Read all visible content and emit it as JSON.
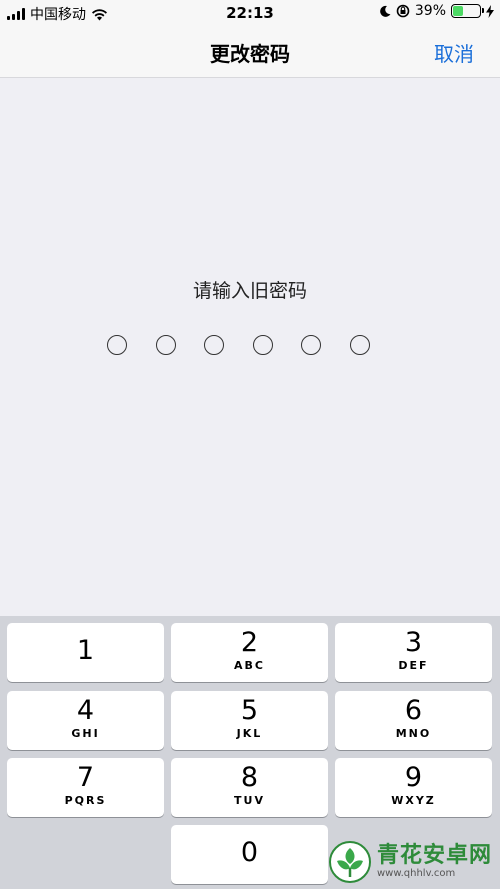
{
  "status_bar": {
    "carrier": "中国移动",
    "time": "22:13",
    "battery_percent": "39%",
    "battery_level": 0.39,
    "icons": [
      "signal-icon",
      "wifi-icon",
      "moon-icon",
      "rotation-lock-icon",
      "battery-icon",
      "charging-icon"
    ]
  },
  "nav": {
    "title": "更改密码",
    "cancel_label": "取消"
  },
  "passcode": {
    "prompt": "请输入旧密码",
    "digits_total": 6,
    "digits_entered": 0
  },
  "keypad": {
    "keys": [
      {
        "num": "1",
        "letters": ""
      },
      {
        "num": "2",
        "letters": "ABC"
      },
      {
        "num": "3",
        "letters": "DEF"
      },
      {
        "num": "4",
        "letters": "GHI"
      },
      {
        "num": "5",
        "letters": "JKL"
      },
      {
        "num": "6",
        "letters": "MNO"
      },
      {
        "num": "7",
        "letters": "PQRS"
      },
      {
        "num": "8",
        "letters": "TUV"
      },
      {
        "num": "9",
        "letters": "WXYZ"
      },
      {
        "num": "0",
        "letters": ""
      }
    ]
  },
  "watermark": {
    "name": "青花安卓网",
    "url": "www.qhhlv.com"
  },
  "colors": {
    "accent": "#1b6fd9",
    "background": "#efeff4",
    "keypad_bg": "#d1d3d9",
    "battery": "#4cd964",
    "watermark": "#2e8b3a"
  }
}
